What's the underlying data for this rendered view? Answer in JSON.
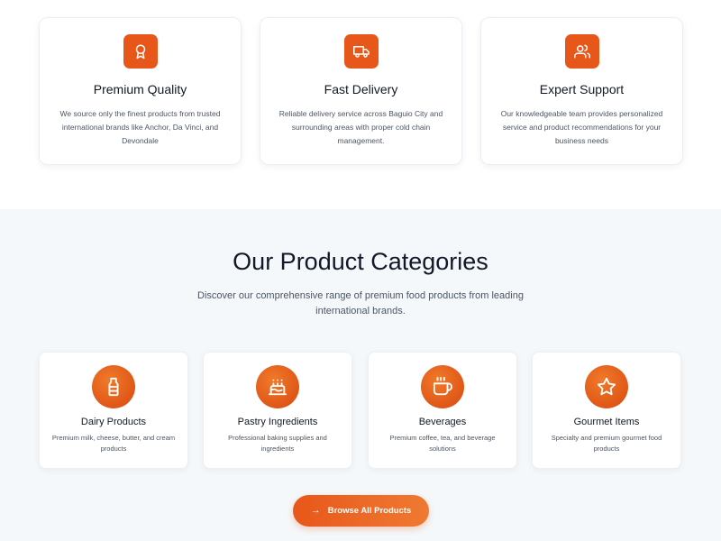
{
  "features": [
    {
      "icon": "award-icon",
      "title": "Premium Quality",
      "desc": "We source only the finest products from trusted international brands like Anchor, Da Vinci, and Devondale"
    },
    {
      "icon": "truck-icon",
      "title": "Fast Delivery",
      "desc": "Reliable delivery service across Baguio City and surrounding areas with proper cold chain management."
    },
    {
      "icon": "users-icon",
      "title": "Expert Support",
      "desc": "Our knowledgeable team provides personalized service and product recommendations for your business needs"
    }
  ],
  "categories_section": {
    "title": "Our Product Categories",
    "subtitle": "Discover our comprehensive range of premium food products from leading international brands."
  },
  "categories": [
    {
      "icon": "milk-bottle-icon",
      "title": "Dairy Products",
      "desc": "Premium milk, cheese, butter, and cream products"
    },
    {
      "icon": "cake-icon",
      "title": "Pastry Ingredients",
      "desc": "Professional baking supplies and ingredients"
    },
    {
      "icon": "coffee-icon",
      "title": "Beverages",
      "desc": "Premium coffee, tea, and beverage solutions"
    },
    {
      "icon": "star-icon",
      "title": "Gourmet Items",
      "desc": "Specialty and premium gourmet food products"
    }
  ],
  "cta": {
    "label": "Browse All Products",
    "icon": "arrow-right-icon"
  },
  "colors": {
    "accent": "#e8571a",
    "section_bg": "#f5f8fa"
  }
}
